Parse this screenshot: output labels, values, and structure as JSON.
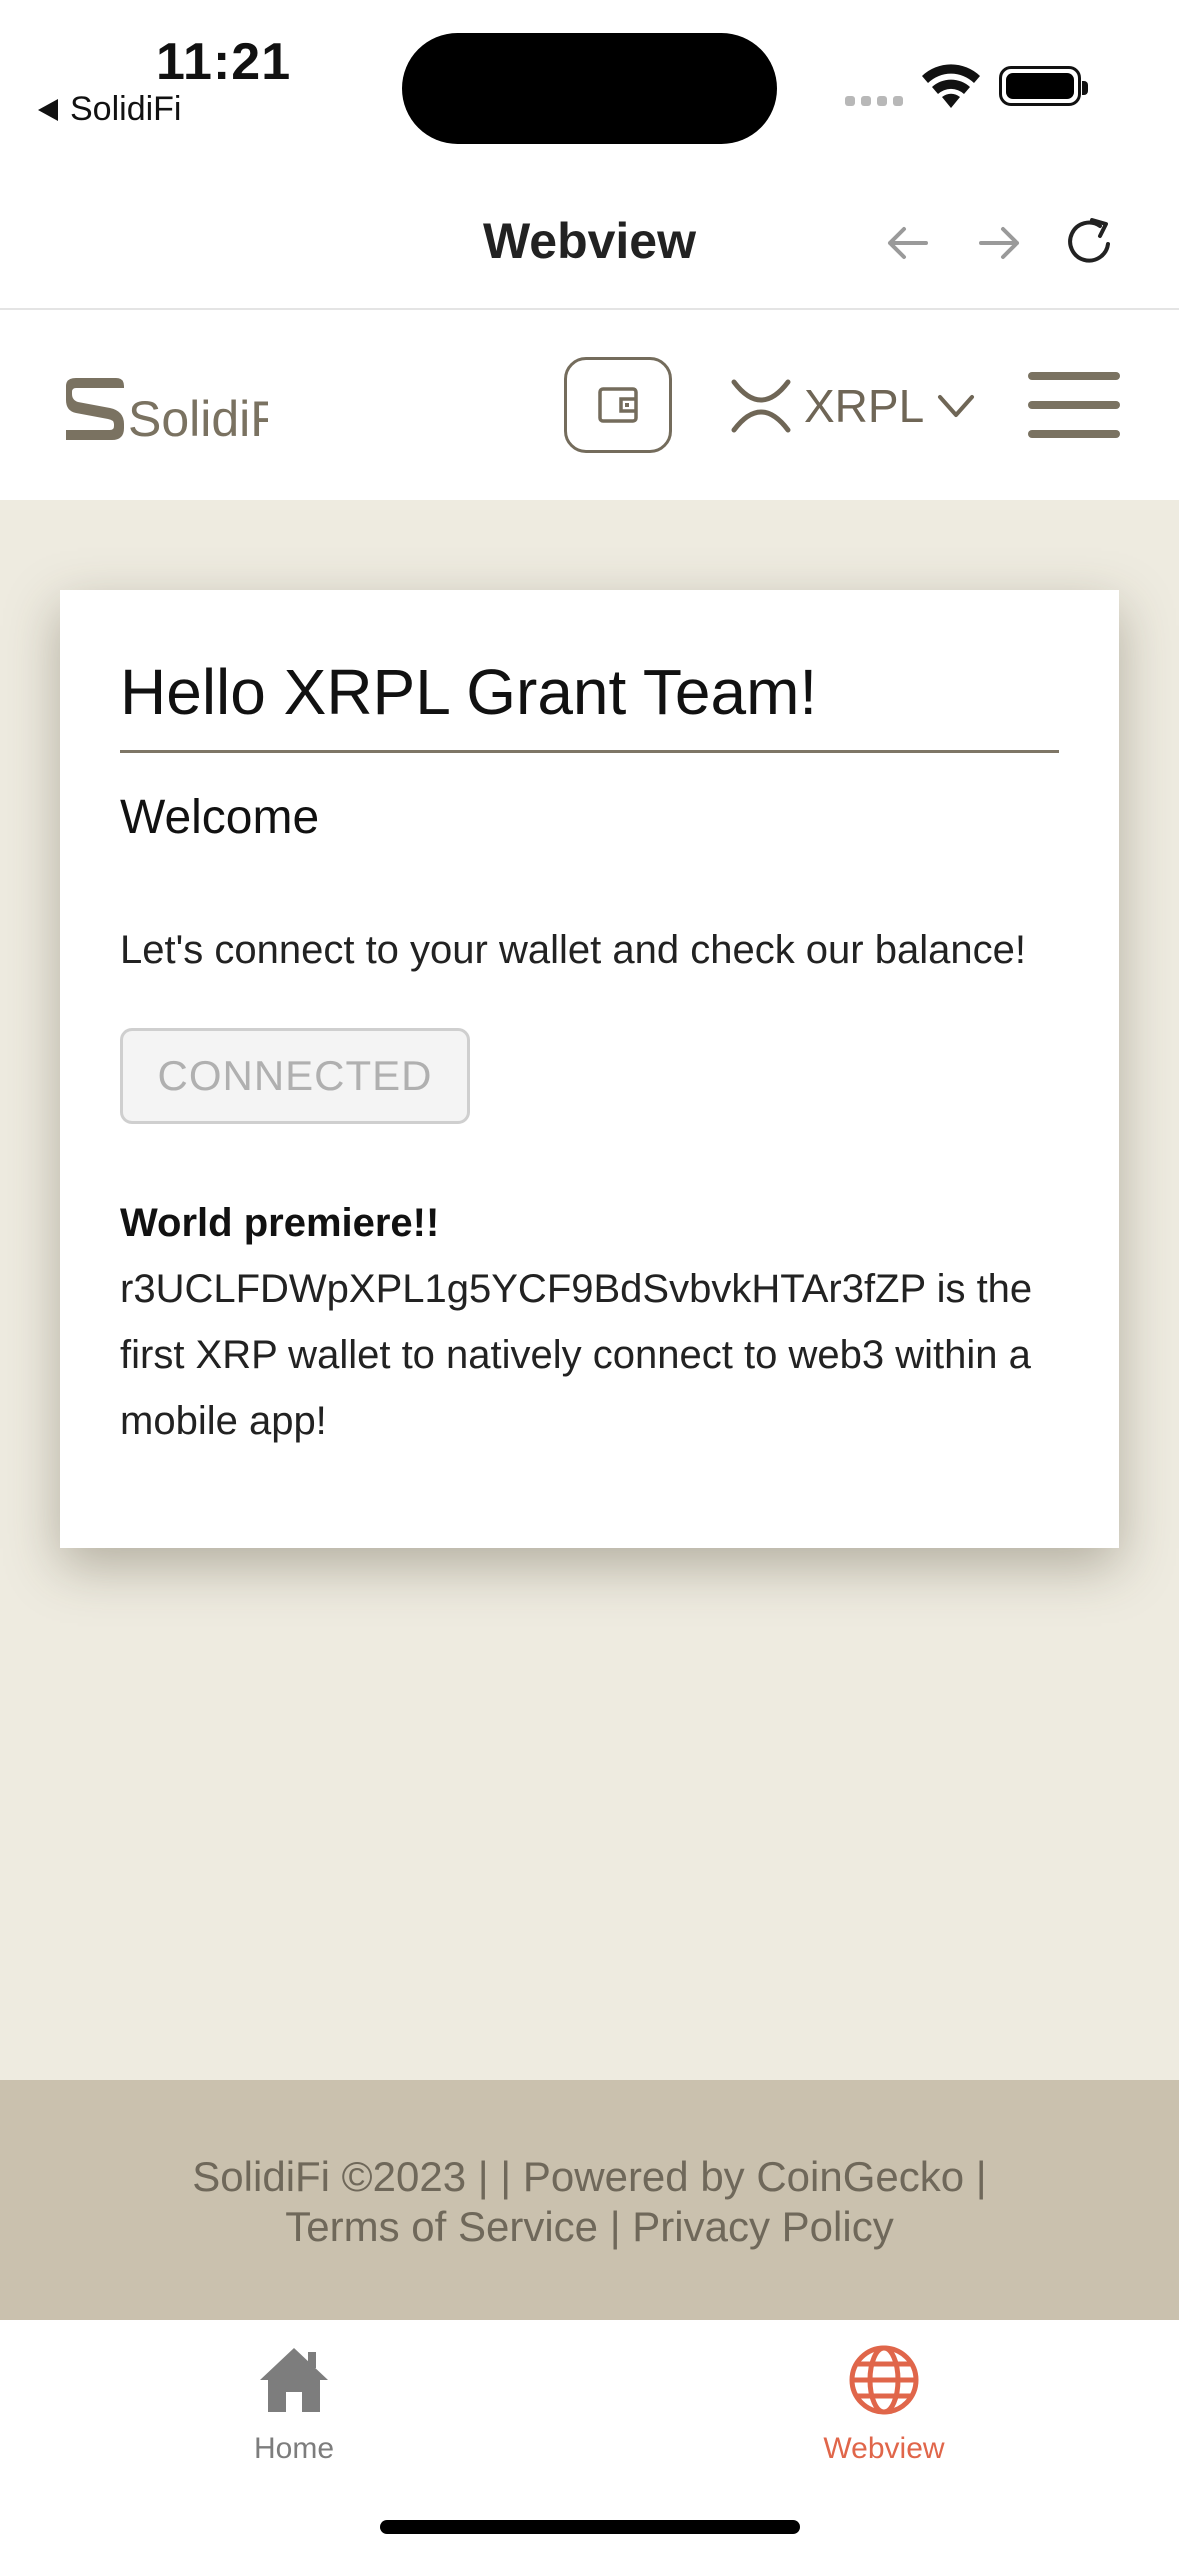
{
  "status_bar": {
    "time": "11:21",
    "back_app": "SolidiFi"
  },
  "nav": {
    "title": "Webview",
    "back_icon": "arrow-left-icon",
    "forward_icon": "arrow-right-icon",
    "reload_icon": "reload-icon"
  },
  "site_header": {
    "logo_text": "SolidiFi",
    "network": "XRPL"
  },
  "card": {
    "title": "Hello XRPL Grant Team!",
    "subtitle": "Welcome",
    "text": "Let's connect to your wallet and check our balance!",
    "button": "CONNECTED",
    "premiere_title": "World premiere!!",
    "premiere_body": "r3UCLFDWpXPL1g5YCF9BdSvbvkHTAr3fZP is the first XRP wallet to natively connect to web3 within a mobile app!"
  },
  "footer": {
    "line1": "SolidiFi ©2023 | | Powered by CoinGecko |",
    "terms": "Terms of Service",
    "separator": "|",
    "privacy": "Privacy Policy"
  },
  "tabs": [
    {
      "label": "Home",
      "icon": "home-icon"
    },
    {
      "label": "Webview",
      "icon": "globe-icon"
    }
  ],
  "colors": {
    "accent": "#e0664a",
    "brand": "#746c5c",
    "background": "#eeebe0",
    "footer": "#cac1ae"
  }
}
